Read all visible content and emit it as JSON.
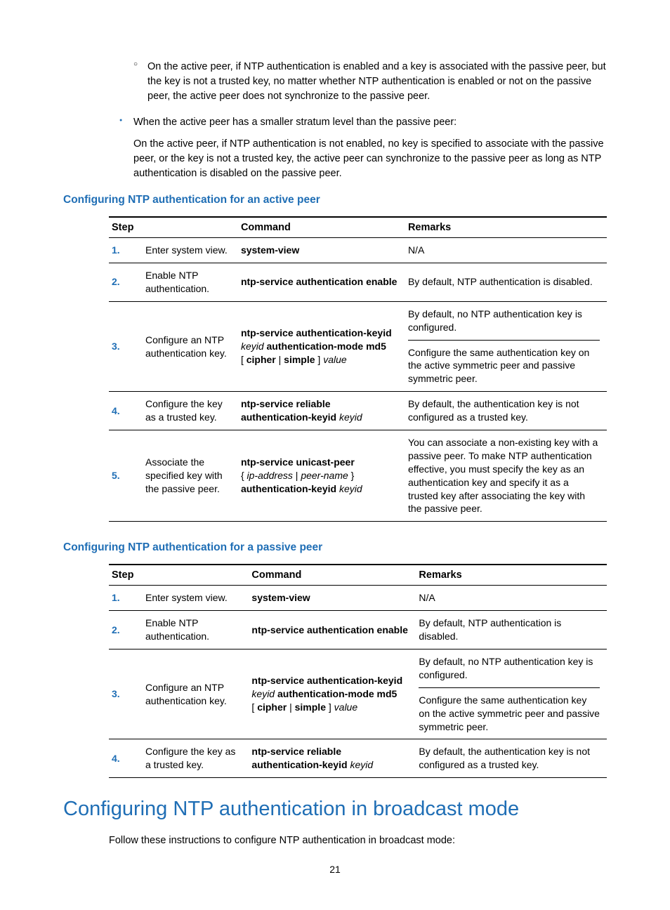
{
  "bullets": {
    "hollow1": "On the active peer, if NTP authentication is enabled and a key is associated with the passive peer, but the key is not a trusted key, no matter whether NTP authentication is enabled or not on the passive peer, the active peer does not synchronize to the passive peer.",
    "solid1": "When the active peer has a smaller stratum level than the passive peer:",
    "sub1": "On the active peer, if NTP authentication is not enabled, no key is specified to associate with the passive peer, or the key is not a trusted key, the active peer can synchronize to the passive peer as long as NTP authentication is disabled on the passive peer."
  },
  "heading_active": "Configuring NTP authentication for an active peer",
  "heading_passive": "Configuring NTP authentication for a passive peer",
  "table_headers": {
    "step": "Step",
    "command": "Command",
    "remarks": "Remarks"
  },
  "table_active": [
    {
      "num": "1.",
      "desc": "Enter system view.",
      "cmd": {
        "bold1": "system-view"
      },
      "rem1": "N/A"
    },
    {
      "num": "2.",
      "desc": "Enable NTP authentication.",
      "cmd": {
        "bold1": "ntp-service authentication enable"
      },
      "rem1": "By default, NTP authentication is disabled."
    },
    {
      "num": "3.",
      "desc": "Configure an NTP authentication key.",
      "cmd": {
        "bold1": "ntp-service authentication-keyid",
        "ital1": "keyid",
        "bold2": "authentication-mode md5",
        "brace1": "[ ",
        "bold3": "cipher",
        "pipe1": " | ",
        "bold4": "simple",
        "brace2": " ] ",
        "ital2": "value"
      },
      "rem1": "By default, no NTP authentication key is configured.",
      "rem2": "Configure the same authentication key on the active symmetric peer and passive symmetric peer."
    },
    {
      "num": "4.",
      "desc": "Configure the key as a trusted key.",
      "cmd": {
        "bold1": "ntp-service reliable authentication-keyid",
        "ital1": "keyid"
      },
      "rem1": "By default, the authentication key is not configured as a trusted key."
    },
    {
      "num": "5.",
      "desc": "Associate the specified key with the passive peer.",
      "cmd": {
        "bold1": "ntp-service unicast-peer",
        "brace1": "{ ",
        "ital1": "ip-address",
        "pipe1": " | ",
        "ital2": "peer-name",
        "brace2": " }",
        "bold2": "authentication-keyid",
        "ital3": "keyid"
      },
      "rem1": "You can associate a non-existing key with a passive peer. To make NTP authentication effective, you must specify the key as an authentication key and specify it as a trusted key after associating the key with the passive peer."
    }
  ],
  "table_passive": [
    {
      "num": "1.",
      "desc": "Enter system view.",
      "cmd": {
        "bold1": "system-view"
      },
      "rem1": "N/A"
    },
    {
      "num": "2.",
      "desc": "Enable NTP authentication.",
      "cmd": {
        "bold1": "ntp-service authentication enable"
      },
      "rem1": "By default, NTP authentication is disabled."
    },
    {
      "num": "3.",
      "desc": "Configure an NTP authentication key.",
      "cmd": {
        "bold1": "ntp-service authentication-keyid",
        "ital1": "keyid",
        "bold2": "authentication-mode md5",
        "brace1": "[ ",
        "bold3": "cipher",
        "pipe1": " | ",
        "bold4": "simple",
        "brace2": " ] ",
        "ital2": "value"
      },
      "rem1": "By default, no NTP authentication key is configured.",
      "rem2": "Configure the same authentication key on the active symmetric peer and passive symmetric peer."
    },
    {
      "num": "4.",
      "desc": "Configure the key as a trusted key.",
      "cmd": {
        "bold1": "ntp-service reliable authentication-keyid",
        "ital1": "keyid"
      },
      "rem1": "By default, the authentication key is not configured as a trusted key."
    }
  ],
  "h2": "Configuring NTP authentication in broadcast mode",
  "body1": "Follow these instructions to configure NTP authentication in broadcast mode:",
  "page_number": "21"
}
